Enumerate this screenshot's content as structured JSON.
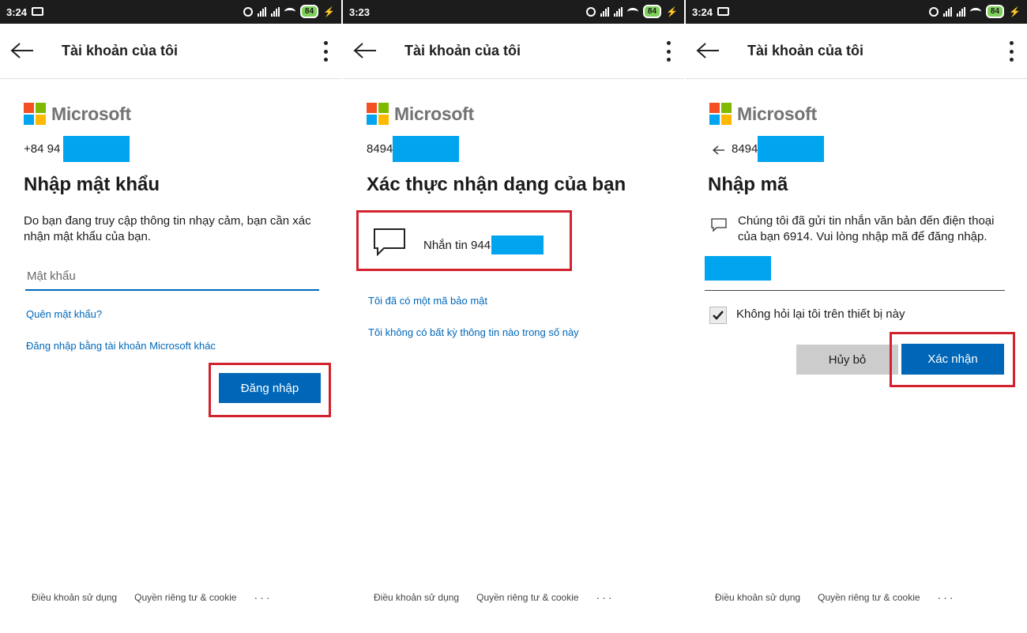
{
  "panels": [
    {
      "status": {
        "time": "3:24",
        "battery": "84"
      },
      "appbar": {
        "title": "Tài khoản của tôi"
      },
      "brand": "Microsoft",
      "identity": "+84 94",
      "heading": "Nhập mật khẩu",
      "description": "Do bạn đang truy cập thông tin nhạy cảm, bạn cần xác nhận mật khẩu của bạn.",
      "password_placeholder": "Mật khẩu",
      "forgot_link": "Quên mật khẩu?",
      "other_account_link": "Đăng nhập bằng tài khoản Microsoft khác",
      "signin_button": "Đăng nhập",
      "footer": {
        "terms": "Điều khoản sử dụng",
        "privacy": "Quyền riêng tư & cookie",
        "more": "···"
      }
    },
    {
      "status": {
        "time": "3:23",
        "battery": "84"
      },
      "appbar": {
        "title": "Tài khoản của tôi"
      },
      "brand": "Microsoft",
      "identity": "8494",
      "heading": "Xác thực nhận dạng của bạn",
      "sms_option": "Nhắn tin 944",
      "have_code_link": "Tôi đã có một mã bảo mật",
      "no_info_link": "Tôi không có bất kỳ thông tin nào trong số này",
      "footer": {
        "terms": "Điều khoản sử dụng",
        "privacy": "Quyền riêng tư & cookie",
        "more": "···"
      }
    },
    {
      "status": {
        "time": "3:24",
        "battery": "84"
      },
      "appbar": {
        "title": "Tài khoản của tôi"
      },
      "brand": "Microsoft",
      "identity": "8494",
      "heading": "Nhập mã",
      "description": "Chúng tôi đã gửi tin nhắn văn bản đến điện thoại của bạn 6914. Vui lòng nhập mã để đăng nhập.",
      "remember_label": "Không hỏi lại tôi trên thiết bị này",
      "remember_checked": true,
      "cancel_button": "Hủy bỏ",
      "confirm_button": "Xác nhận",
      "footer": {
        "terms": "Điều khoản sử dụng",
        "privacy": "Quyền riêng tư & cookie",
        "more": "···"
      }
    }
  ],
  "colors": {
    "accent": "#0067b8",
    "redaction": "#00a4ef",
    "highlight": "#d2222d",
    "status_bar": "#1c1c1c",
    "battery": "#7ed05a",
    "secondary_button": "#cccccc"
  },
  "icons": [
    "message-icon",
    "alarm-icon",
    "signal-icon",
    "wifi-icon",
    "battery-icon",
    "charging-icon",
    "back-arrow-icon",
    "more-vert-icon",
    "microsoft-logo-icon",
    "chat-bubble-icon",
    "checkmark-icon"
  ]
}
